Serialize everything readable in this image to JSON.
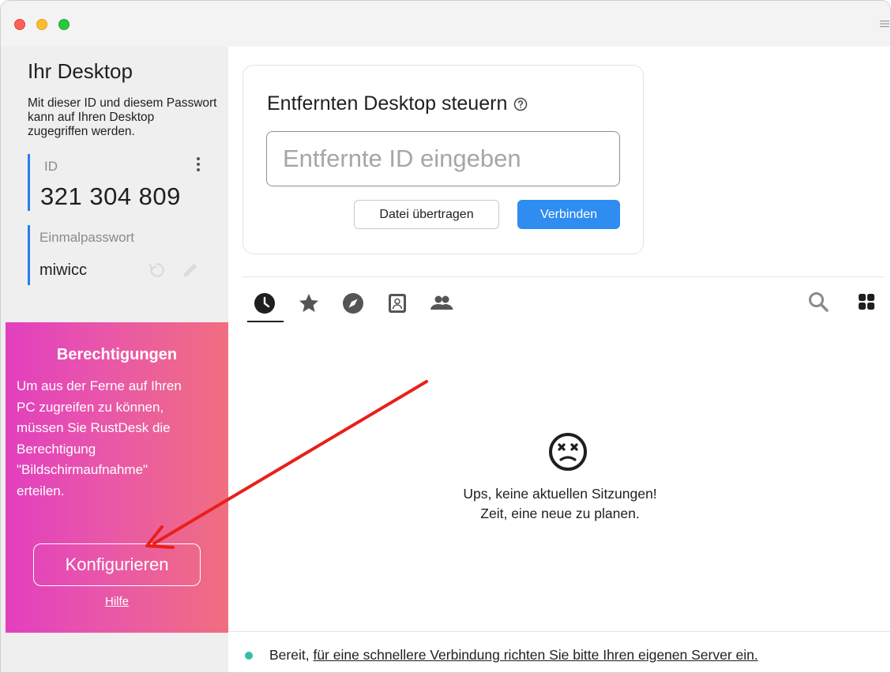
{
  "sidebar": {
    "title": "Ihr Desktop",
    "description": "Mit dieser ID und diesem Passwort kann auf Ihren Desktop zugegriffen werden.",
    "id_label": "ID",
    "id_value": "321 304 809",
    "password_label": "Einmalpasswort",
    "password_value": "miwicc",
    "permissions": {
      "title": "Berechtigungen",
      "text": "Um aus der Ferne auf Ihren PC zugreifen zu können, müssen Sie RustDesk die Berechtigung \"Bildschirmaufnahme\" erteilen.",
      "configure_label": "Konfigurieren",
      "help_label": "Hilfe"
    }
  },
  "remote": {
    "title": "Entfernten Desktop steuern",
    "input_placeholder": "Entfernte ID eingeben",
    "input_value": "",
    "file_transfer_label": "Datei übertragen",
    "connect_label": "Verbinden"
  },
  "tabs": [
    {
      "icon": "clock-icon",
      "name": "recent-sessions",
      "active": true
    },
    {
      "icon": "star-icon",
      "name": "favorites",
      "active": false
    },
    {
      "icon": "compass-icon",
      "name": "discovered",
      "active": false
    },
    {
      "icon": "address-book-icon",
      "name": "address-book",
      "active": false
    },
    {
      "icon": "group-icon",
      "name": "group",
      "active": false
    }
  ],
  "empty_state": {
    "line1": "Ups, keine aktuellen Sitzungen!",
    "line2": "Zeit, eine neue zu planen."
  },
  "status": {
    "ready_text": "Bereit, ",
    "link_text": "für eine schnellere Verbindung richten Sie bitte Ihren eigenen Server ein.",
    "dot_color": "#32bfa4"
  },
  "colors": {
    "accent": "#2f8cf0",
    "id_border": "#2b7bf0",
    "annotation_arrow": "#e8201a"
  }
}
